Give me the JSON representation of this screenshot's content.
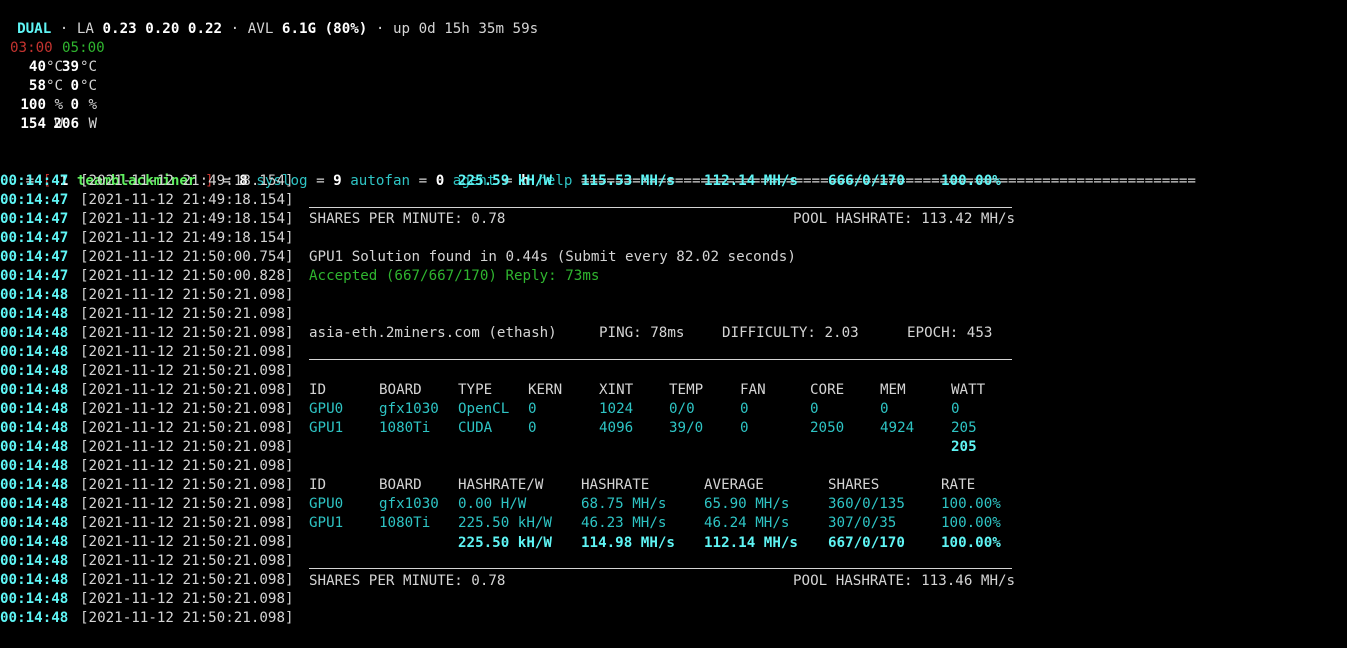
{
  "header": {
    "dual": "DUAL",
    "dot1": " · ",
    "la_label": "LA ",
    "la_values": "0.23 0.20 0.22",
    "dot2": " · ",
    "avl_label": "AVL ",
    "avl_value": "6.1G (80%)",
    "dot3": " · ",
    "uptime": "up 0d 15h 35m 59s"
  },
  "gpu_panel": {
    "times": [
      "03:00",
      "05:00"
    ],
    "rows": [
      [
        "40",
        "°C",
        "39",
        "°C"
      ],
      [
        "58",
        "°C",
        "0",
        "°C"
      ],
      [
        "100",
        " %",
        "0",
        " %"
      ],
      [
        "154",
        " W",
        "206",
        " W"
      ]
    ]
  },
  "menu": {
    "eq_prefix": " = ",
    "bracket_open": "[",
    "item1_key": " 1 ",
    "item1_label": "teamblackminer",
    "bracket_close": " ]",
    "eq2": " = ",
    "item8_key": "8",
    "item8_label": " syslog",
    "eq3": " = ",
    "item9_key": "9",
    "item9_label": " autofan",
    "eq4": " = ",
    "item0_key": "0",
    "item0_label": " agent",
    "eq5": " = ",
    "itemh_key": "h",
    "itemh_label": " help ",
    "trail": "========================================================================"
  },
  "log": {
    "lines": [
      {
        "time": "00:14:47",
        "stamp": "[2021-11-12 21:49:18.154]"
      },
      {
        "time": "00:14:47",
        "stamp": "[2021-11-12 21:49:18.154]"
      },
      {
        "time": "00:14:47",
        "stamp": "[2021-11-12 21:49:18.154]"
      },
      {
        "time": "00:14:47",
        "stamp": "[2021-11-12 21:49:18.154]"
      },
      {
        "time": "00:14:47",
        "stamp": "[2021-11-12 21:50:00.754]"
      },
      {
        "time": "00:14:47",
        "stamp": "[2021-11-12 21:50:00.828]"
      },
      {
        "time": "00:14:48",
        "stamp": "[2021-11-12 21:50:21.098]"
      },
      {
        "time": "00:14:48",
        "stamp": "[2021-11-12 21:50:21.098]"
      },
      {
        "time": "00:14:48",
        "stamp": "[2021-11-12 21:50:21.098]"
      },
      {
        "time": "00:14:48",
        "stamp": "[2021-11-12 21:50:21.098]"
      },
      {
        "time": "00:14:48",
        "stamp": "[2021-11-12 21:50:21.098]"
      },
      {
        "time": "00:14:48",
        "stamp": "[2021-11-12 21:50:21.098]"
      },
      {
        "time": "00:14:48",
        "stamp": "[2021-11-12 21:50:21.098]"
      },
      {
        "time": "00:14:48",
        "stamp": "[2021-11-12 21:50:21.098]"
      },
      {
        "time": "00:14:48",
        "stamp": "[2021-11-12 21:50:21.098]"
      },
      {
        "time": "00:14:48",
        "stamp": "[2021-11-12 21:50:21.098]"
      },
      {
        "time": "00:14:48",
        "stamp": "[2021-11-12 21:50:21.098]"
      },
      {
        "time": "00:14:48",
        "stamp": "[2021-11-12 21:50:21.098]"
      },
      {
        "time": "00:14:48",
        "stamp": "[2021-11-12 21:50:21.098]"
      },
      {
        "time": "00:14:48",
        "stamp": "[2021-11-12 21:50:21.098]"
      },
      {
        "time": "00:14:48",
        "stamp": "[2021-11-12 21:50:21.098]"
      },
      {
        "time": "00:14:48",
        "stamp": "[2021-11-12 21:50:21.098]"
      },
      {
        "time": "00:14:48",
        "stamp": "[2021-11-12 21:50:21.098]"
      },
      {
        "time": "00:14:48",
        "stamp": "[2021-11-12 21:50:21.098]"
      }
    ]
  },
  "total1": {
    "eff": "225.59 kH/W",
    "hashrate": "115.53 MH/s",
    "average": "112.14 MH/s",
    "shares": "666/0/170",
    "rate": "100.00%"
  },
  "spm1": {
    "label": "SHARES PER MINUTE: 0.78",
    "pool": "POOL HASHRATE: 113.42 MH/s"
  },
  "solution": "GPU1 Solution found in 0.44s (Submit every 82.02 seconds)",
  "accepted": "Accepted (667/667/170) Reply: 73ms",
  "pool_info": {
    "host": "asia-eth.2miners.com (ethash)",
    "ping": "PING: 78ms",
    "difficulty": "DIFFICULTY: 2.03",
    "epoch": "EPOCH: 453"
  },
  "hw_table": {
    "headers": [
      "ID",
      "BOARD",
      "TYPE",
      "KERN",
      "XINT",
      "TEMP",
      "FAN",
      "CORE",
      "MEM",
      "WATT"
    ],
    "rows": [
      [
        "GPU0",
        "gfx1030",
        "OpenCL",
        "0",
        "1024",
        "0/0",
        "0",
        "0",
        "0",
        "0"
      ],
      [
        "GPU1",
        "1080Ti",
        "CUDA",
        "0",
        "4096",
        "39/0",
        "0",
        "2050",
        "4924",
        "205"
      ]
    ],
    "total_watt": "205"
  },
  "hash_table": {
    "headers": [
      "ID",
      "BOARD",
      "HASHRATE/W",
      "HASHRATE",
      "AVERAGE",
      "SHARES",
      "RATE"
    ],
    "rows": [
      [
        "GPU0",
        "gfx1030",
        "0.00 H/W",
        "68.75 MH/s",
        "65.90 MH/s",
        "360/0/135",
        "100.00%"
      ],
      [
        "GPU1",
        "1080Ti",
        "225.50 kH/W",
        "46.23 MH/s",
        "46.24 MH/s",
        "307/0/35",
        "100.00%"
      ]
    ],
    "totals": [
      "225.50 kH/W",
      "114.98 MH/s",
      "112.14 MH/s",
      "667/0/170",
      "100.00%"
    ]
  },
  "spm2": {
    "label": "SHARES PER MINUTE: 0.78",
    "pool": "POOL HASHRATE: 113.46 MH/s"
  }
}
